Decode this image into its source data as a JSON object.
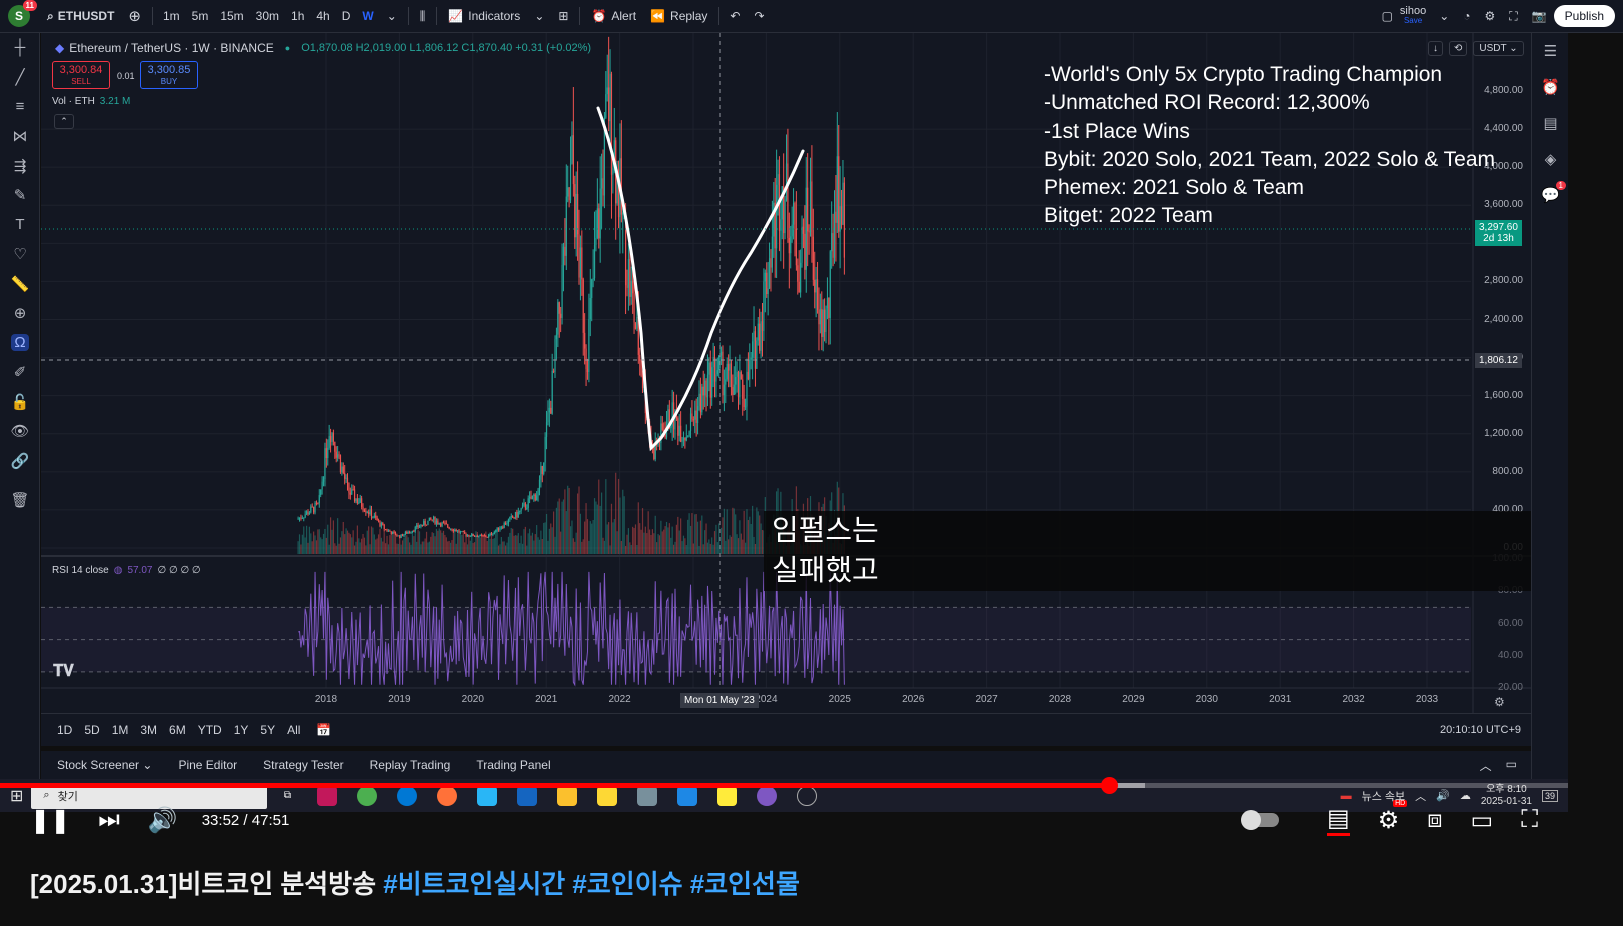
{
  "topbar": {
    "avatar_letter": "S",
    "avatar_notifications": "11",
    "symbol": "ETHUSDT",
    "timeframes": [
      "1m",
      "5m",
      "15m",
      "30m",
      "1h",
      "4h",
      "D",
      "W"
    ],
    "active_timeframe": "W",
    "indicators_label": "Indicators",
    "alert_label": "Alert",
    "replay_label": "Replay",
    "user_name": "sihoo",
    "user_status": "Save",
    "publish_label": "Publish"
  },
  "chart": {
    "symbol_title": "Ethereum / TetherUS · 1W · BINANCE",
    "ohlc": "O1,870.08  H2,019.00  L1,806.12  C1,870.40  +0.31 (+0.02%)",
    "sell_price": "3,300.84",
    "sell_label": "SELL",
    "spread": "0.01",
    "buy_price": "3,300.85",
    "buy_label": "BUY",
    "volume_label": "Vol · ETH",
    "volume_value": "3.21 M",
    "rsi_label": "RSI 14 close",
    "rsi_value": "57.07",
    "rsi_extra": "∅ ∅ ∅ ∅",
    "currency": "USDT",
    "last_price": "3,297.60",
    "countdown": "2d 13h",
    "crosshair_price": "1,806.12",
    "crosshair_date": "Mon 01 May '23",
    "clock": "20:10:10 UTC+9"
  },
  "overlay_lines": [
    "-World's Only 5x Crypto Trading Champion",
    "-Unmatched ROI Record: 12,300%",
    "-1st Place Wins",
    "Bybit: 2020 Solo, 2021 Team, 2022 Solo & Team",
    "Phemex: 2021 Solo & Team",
    "Bitget: 2022 Team"
  ],
  "subtitle_lines": [
    "임펄스는",
    "실패했고"
  ],
  "ranges": [
    "1D",
    "5D",
    "1M",
    "3M",
    "6M",
    "YTD",
    "1Y",
    "5Y",
    "All"
  ],
  "bottom_tabs": [
    "Stock Screener",
    "Pine Editor",
    "Strategy Tester",
    "Replay Trading",
    "Trading Panel"
  ],
  "taskbar": {
    "search_label": "찾기",
    "news_label": "뉴스 속보",
    "time": "오후 8:10",
    "date": "2025-01-31",
    "badge": "39"
  },
  "player": {
    "time_display": "33:52 / 47:51",
    "progress": 0.7075,
    "buffered": 0.73
  },
  "video_title": {
    "main": "[2025.01.31]비트코인 분석방송 ",
    "tags": "#비트코인실시간 #코인이슈 #코인선물"
  },
  "price_axis": [
    "4,800.00",
    "4,400.00",
    "4,000.00",
    "3,600.00",
    "2,800.00",
    "2,400.00",
    "2,000.00",
    "1,600.00",
    "1,200.00",
    "800.00",
    "400.00",
    "0.00"
  ],
  "rsi_axis": [
    "100.00",
    "80.00",
    "60.00",
    "40.00",
    "20.00"
  ],
  "time_axis": [
    "2018",
    "2019",
    "2020",
    "2021",
    "2022",
    "2024",
    "2025",
    "2026",
    "2027",
    "2028",
    "2029",
    "2030",
    "2031",
    "2032",
    "2033"
  ],
  "colors": {
    "up": "#26a69a",
    "down": "#ef5350",
    "rsi": "#7e57c2",
    "accent": "#2962ff",
    "progress": "#ff0000"
  },
  "icons": {
    "left": [
      "crosshair-icon",
      "trend-line-icon",
      "fib-icon",
      "pattern-icon",
      "projection-icon",
      "brush-icon",
      "text-icon",
      "heart-icon",
      "ruler-icon",
      "zoom-icon",
      "magnet-icon",
      "pencil-lock-icon",
      "lock-icon",
      "eye-icon",
      "link-icon",
      "trash-icon"
    ],
    "right": [
      "watchlist-icon",
      "alarm-icon",
      "news-icon",
      "layers-icon",
      "chat-icon"
    ]
  }
}
